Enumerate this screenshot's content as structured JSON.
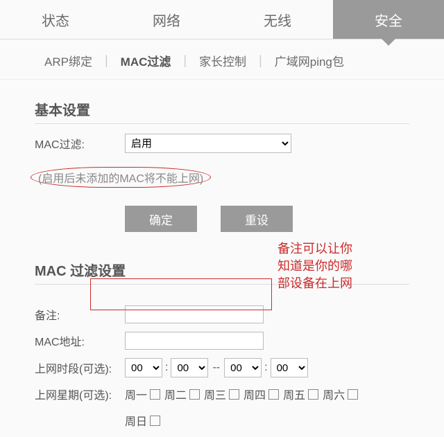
{
  "main_tabs": {
    "status": "状态",
    "network": "网络",
    "wireless": "无线",
    "security": "安全"
  },
  "sub_tabs": {
    "arp": "ARP绑定",
    "mac": "MAC过滤",
    "parent": "家长控制",
    "wanping": "广域网ping包"
  },
  "basic": {
    "title": "基本设置",
    "filter_label": "MAC过滤:",
    "filter_value": "启用",
    "hint": "(启用后未添加的MAC将不能上网)",
    "ok": "确定",
    "reset": "重设"
  },
  "filter": {
    "title": "MAC 过滤设置",
    "remark_label": "备注:",
    "mac_label": "MAC地址:",
    "time_label": "上网时段(可选):",
    "week_label": "上网星期(可选):",
    "hour": "00",
    "minute": "00",
    "days": [
      "周一",
      "周二",
      "周三",
      "周四",
      "周五",
      "周六",
      "周日"
    ]
  },
  "annotation": "备注可以让你\n知道是你的哪\n部设备在上网"
}
